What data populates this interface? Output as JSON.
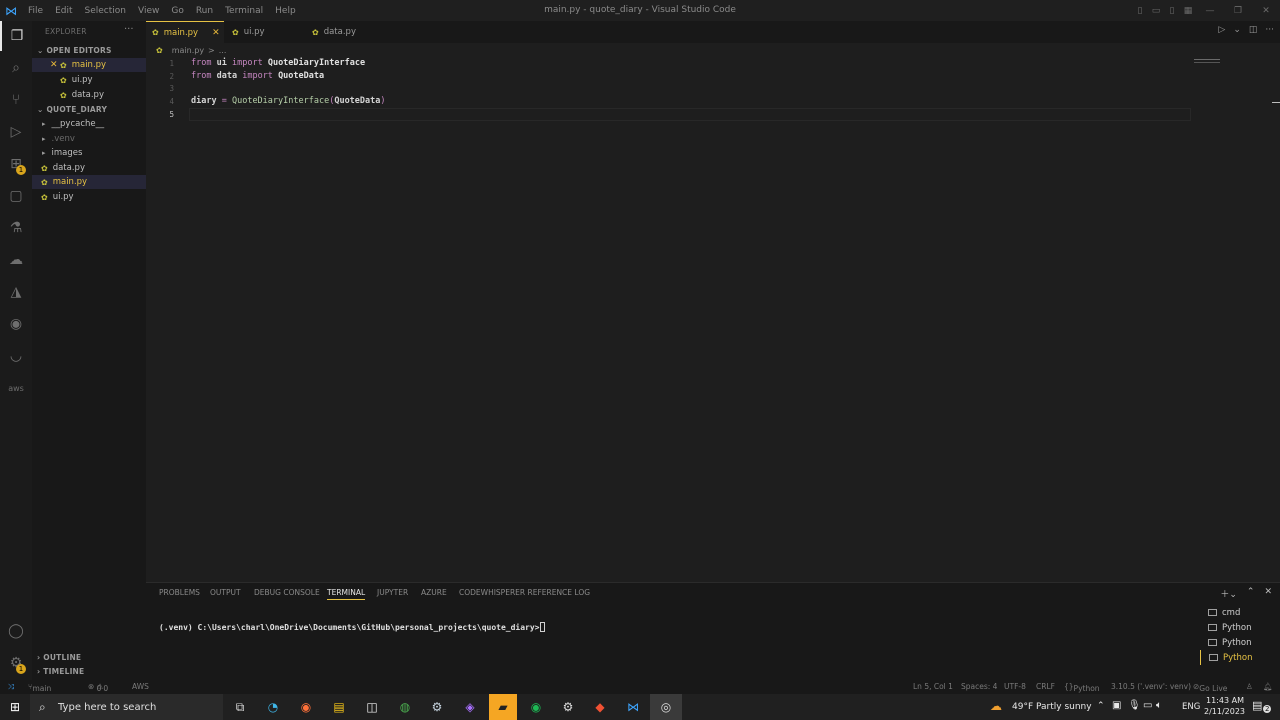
{
  "window": {
    "title": "main.py - quote_diary - Visual Studio Code",
    "menu": [
      "File",
      "Edit",
      "Selection",
      "View",
      "Go",
      "Run",
      "Terminal",
      "Help"
    ]
  },
  "sidebar": {
    "header": "EXPLORER",
    "open_editors_label": "OPEN EDITORS",
    "open_editors": [
      "main.py",
      "ui.py",
      "data.py"
    ],
    "folder_label": "QUOTE_DIARY",
    "items": [
      "__pycache__",
      ".venv",
      "images",
      "data.py",
      "main.py",
      "ui.py"
    ],
    "outline_label": "OUTLINE",
    "timeline_label": "TIMELINE"
  },
  "tabs": [
    "main.py",
    "ui.py",
    "data.py"
  ],
  "breadcrumb": [
    "main.py",
    ">",
    "..."
  ],
  "editor": {
    "line_numbers": [
      "1",
      "2",
      "3",
      "4",
      "5"
    ],
    "lines": [
      {
        "kw1": "from",
        "mod": "ui",
        "kw2": "import",
        "name": "QuoteDiaryInterface"
      },
      {
        "kw1": "from",
        "mod": "data",
        "kw2": "import",
        "name": "QuoteData"
      },
      {},
      {
        "var": "diary",
        "op": "=",
        "call": "QuoteDiaryInterface",
        "arg": "QuoteData"
      }
    ]
  },
  "panel": {
    "tabs": [
      "PROBLEMS",
      "OUTPUT",
      "DEBUG CONSOLE",
      "TERMINAL",
      "JUPYTER",
      "AZURE",
      "CODEWHISPERER REFERENCE LOG"
    ],
    "active_tab": "TERMINAL",
    "terminal_prompt": "(.venv) C:\\Users\\charl\\OneDrive\\Documents\\GitHub\\personal_projects\\quote_diary>",
    "terminals": [
      "cmd",
      "Python",
      "Python",
      "Python"
    ]
  },
  "status": {
    "branch": "main",
    "errors": "0",
    "warnings": "0",
    "aws": "AWS",
    "position": "Ln 5, Col 1",
    "spaces": "Spaces: 4",
    "encoding": "UTF-8",
    "eol": "CRLF",
    "language": "Python",
    "interpreter": "3.10.5 ('.venv': venv)",
    "golive": "Go Live"
  },
  "taskbar": {
    "search_placeholder": "Type here to search",
    "weather": "49°F  Partly sunny",
    "lang": "ENG",
    "time": "11:43 AM",
    "date": "2/11/2023",
    "notifications": "2"
  },
  "colors": {
    "accent": "#e6c244",
    "editor_bg": "#1e1e1e",
    "keyword": "#c586c0",
    "function": "#b5cea8"
  }
}
